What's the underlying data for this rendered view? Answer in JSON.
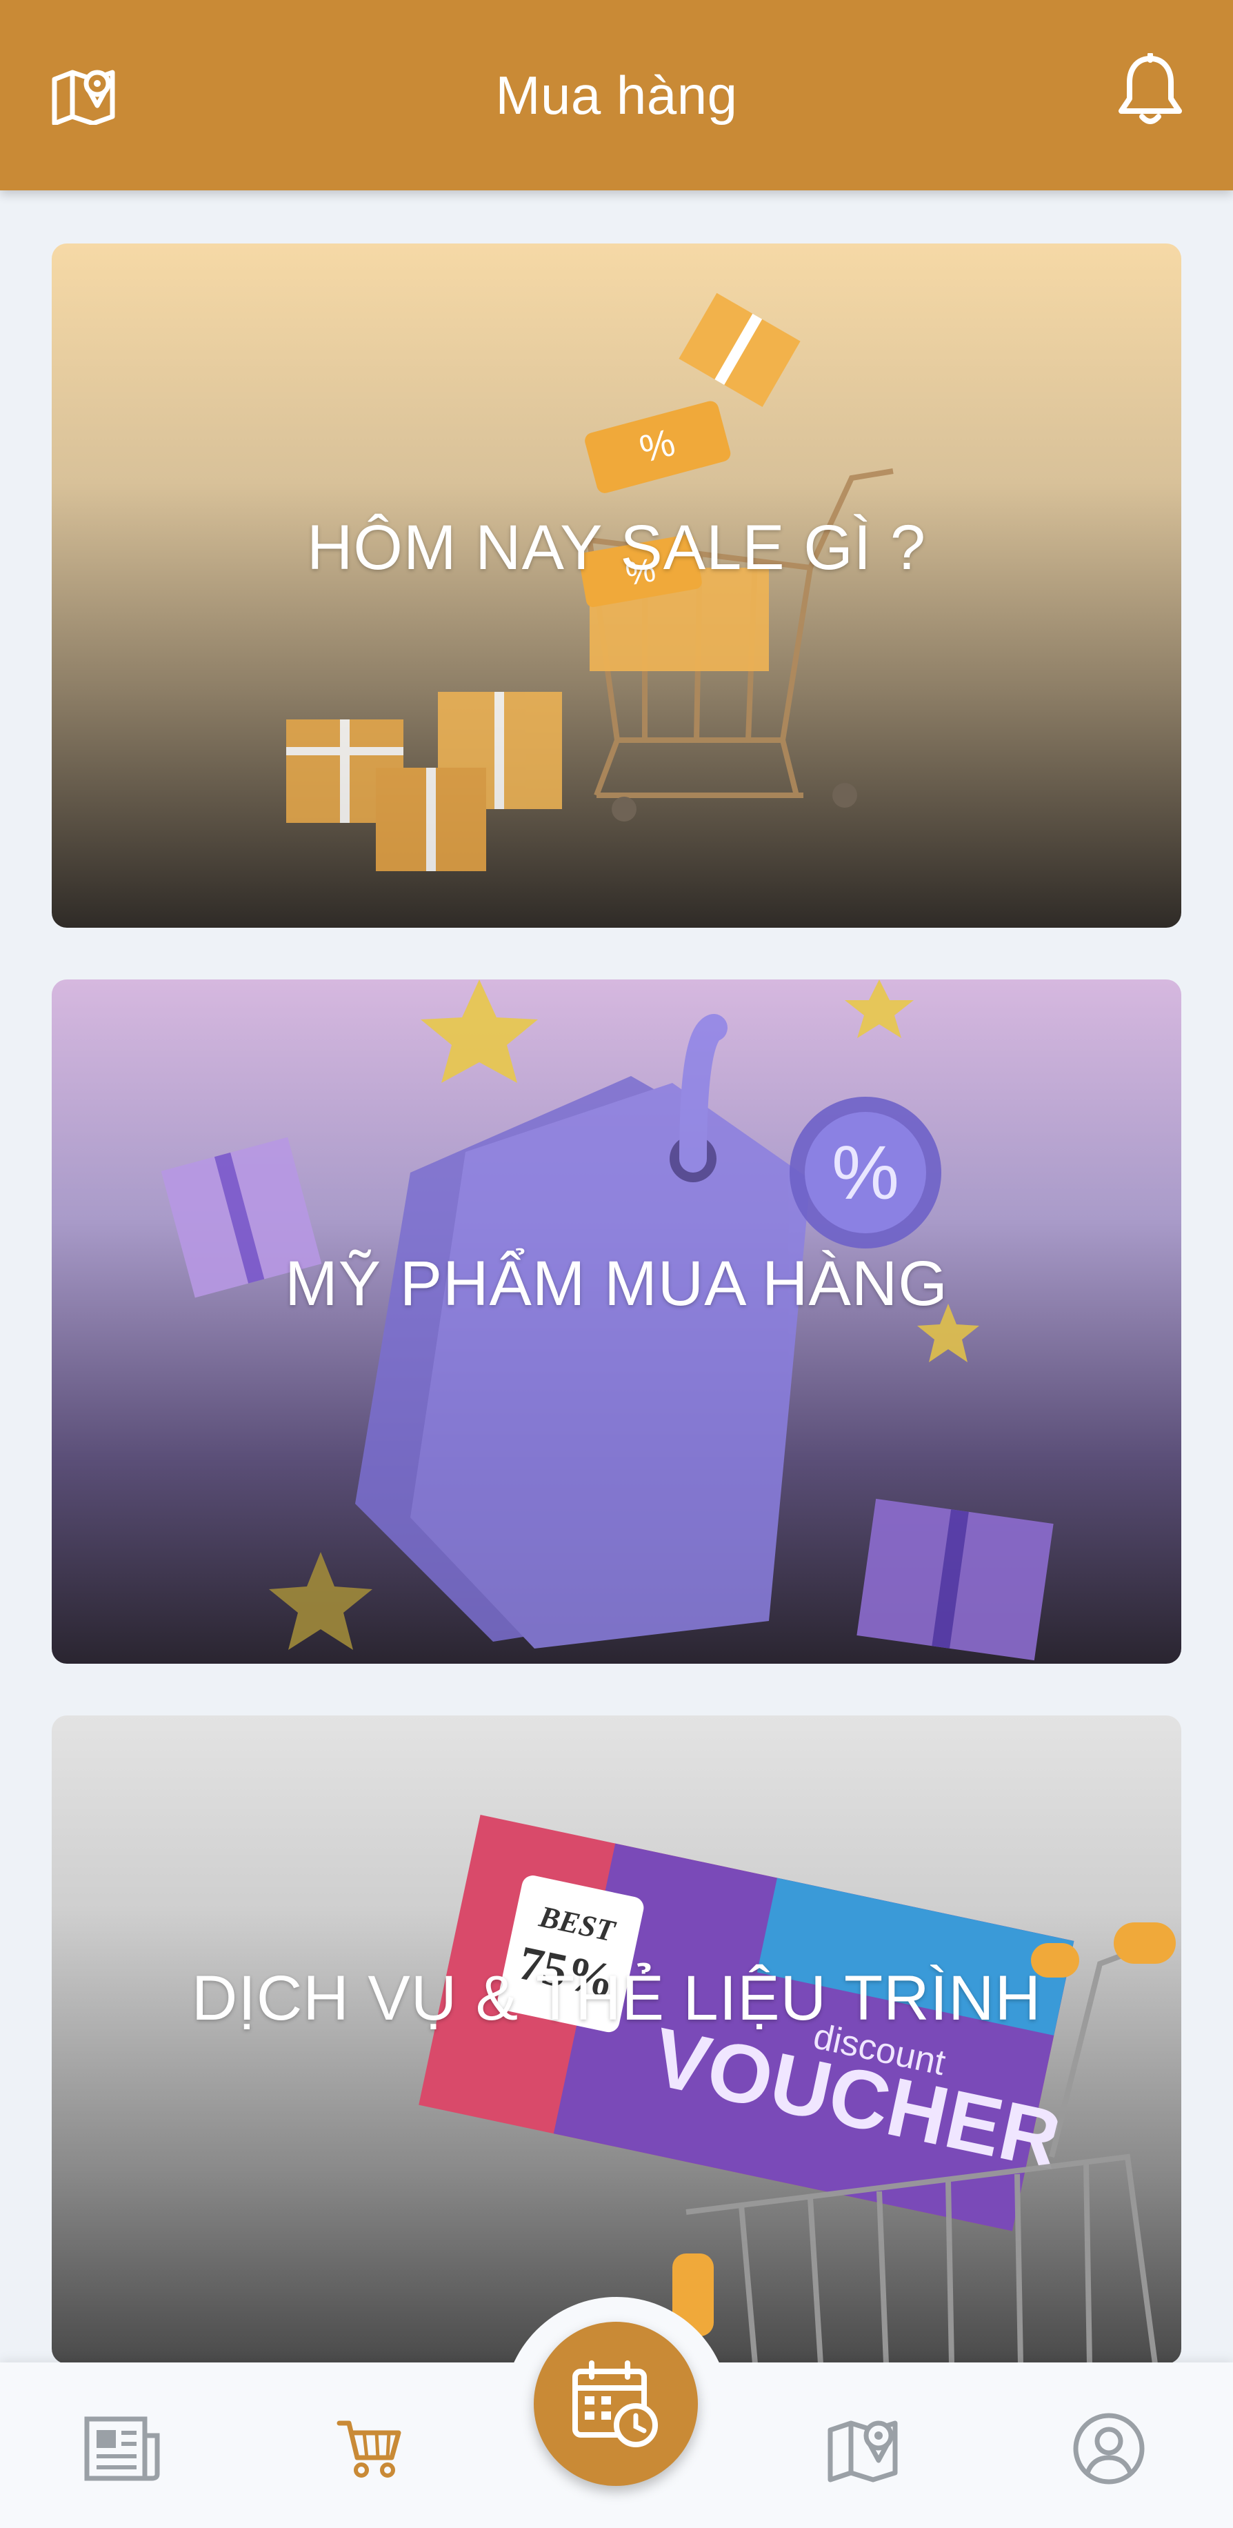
{
  "header": {
    "title": "Mua hàng",
    "left_icon": "map-pin-icon",
    "right_icon": "bell-icon",
    "color": "#c98a36"
  },
  "cards": [
    {
      "label": "HÔM NAY SALE GÌ ?"
    },
    {
      "label": "MỸ PHẨM MUA HÀNG"
    },
    {
      "label": "DỊCH VỤ & THẺ LIỆU TRÌNH"
    }
  ],
  "card3_art": {
    "badge_line1": "BEST",
    "badge_line2": "75%",
    "voucher_small": "discount",
    "voucher_big": "VOUCHER"
  },
  "bottom_nav": {
    "items": [
      {
        "icon": "newspaper-icon",
        "active": false
      },
      {
        "icon": "cart-icon",
        "active": true
      },
      {
        "icon": "calendar-clock-icon",
        "active": true
      },
      {
        "icon": "map-pin-icon",
        "active": false
      },
      {
        "icon": "user-circle-icon",
        "active": false
      }
    ],
    "active_color": "#c98a36",
    "inactive_color": "#9aa0a6"
  }
}
